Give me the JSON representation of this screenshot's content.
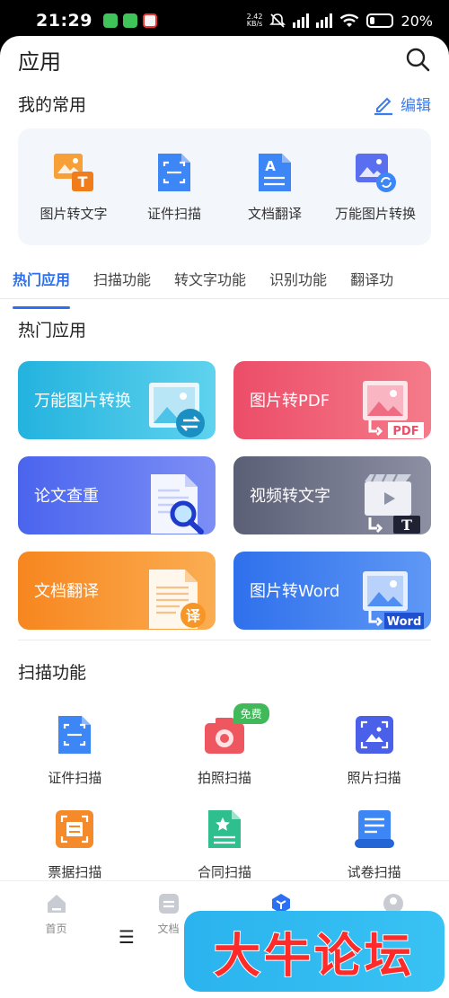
{
  "status": {
    "time": "21:29",
    "speed": "2.42\nKB/s",
    "battery": "20%"
  },
  "header": {
    "title": "应用",
    "search_icon": "search-icon"
  },
  "favorites": {
    "title": "我的常用",
    "edit_label": "编辑",
    "items": [
      {
        "label": "图片转文字",
        "icon": "image-to-text-icon"
      },
      {
        "label": "证件扫描",
        "icon": "id-scan-icon"
      },
      {
        "label": "文档翻译",
        "icon": "doc-translate-icon"
      },
      {
        "label": "万能图片转换",
        "icon": "image-convert-icon"
      }
    ]
  },
  "tabs": [
    {
      "label": "热门应用",
      "active": true
    },
    {
      "label": "扫描功能"
    },
    {
      "label": "转文字功能"
    },
    {
      "label": "识别功能"
    },
    {
      "label": "翻译功"
    }
  ],
  "hot": {
    "title": "热门应用",
    "cards": [
      {
        "label": "万能图片转换",
        "color": "#2ab8e0"
      },
      {
        "label": "图片转PDF",
        "color": "#e9506a"
      },
      {
        "label": "论文查重",
        "color": "#4c6ff0"
      },
      {
        "label": "视频转文字",
        "color": "#5f6378"
      },
      {
        "label": "文档翻译",
        "color": "#f7861f"
      },
      {
        "label": "图片转Word",
        "color": "#3b7df0"
      }
    ],
    "badges": {
      "pdf": "PDF",
      "word": "Word",
      "translate": "译",
      "text_t": "T"
    }
  },
  "scan": {
    "title": "扫描功能",
    "free_badge": "免费",
    "items": [
      {
        "label": "证件扫描",
        "icon": "id-scan-icon"
      },
      {
        "label": "拍照扫描",
        "icon": "camera-scan-icon"
      },
      {
        "label": "照片扫描",
        "icon": "photo-scan-icon"
      },
      {
        "label": "票据扫描",
        "icon": "receipt-scan-icon"
      },
      {
        "label": "合同扫描",
        "icon": "contract-scan-icon"
      },
      {
        "label": "试卷扫描",
        "icon": "exam-scan-icon"
      }
    ]
  },
  "bottom_nav": [
    {
      "label": "首页"
    },
    {
      "label": "文档"
    },
    {
      "label": ""
    },
    {
      "label": ""
    }
  ],
  "watermark": "大牛论坛",
  "menu_glyph": "☰"
}
